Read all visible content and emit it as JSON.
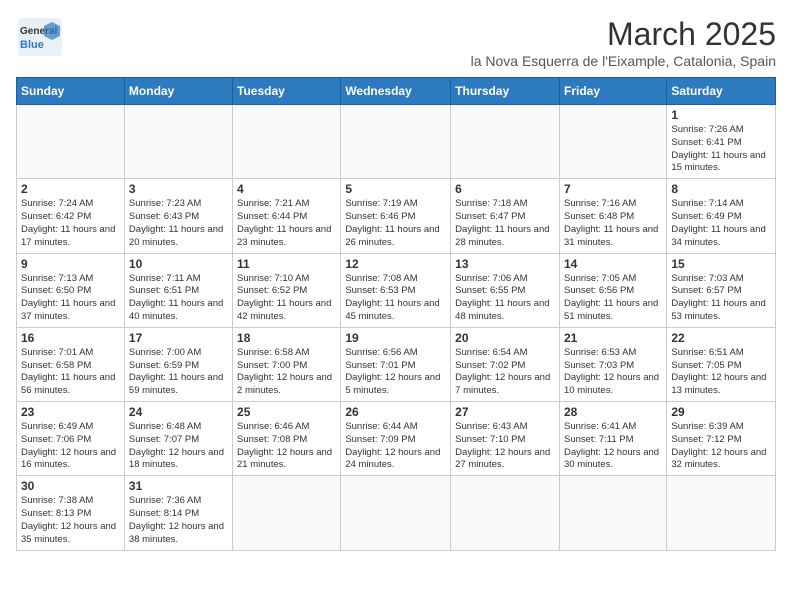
{
  "logo": {
    "text_general": "General",
    "text_blue": "Blue"
  },
  "header": {
    "month": "March 2025",
    "location": "la Nova Esquerra de l'Eixample, Catalonia, Spain"
  },
  "weekdays": [
    "Sunday",
    "Monday",
    "Tuesday",
    "Wednesday",
    "Thursday",
    "Friday",
    "Saturday"
  ],
  "weeks": [
    [
      {
        "day": "",
        "info": ""
      },
      {
        "day": "",
        "info": ""
      },
      {
        "day": "",
        "info": ""
      },
      {
        "day": "",
        "info": ""
      },
      {
        "day": "",
        "info": ""
      },
      {
        "day": "",
        "info": ""
      },
      {
        "day": "1",
        "info": "Sunrise: 7:26 AM\nSunset: 6:41 PM\nDaylight: 11 hours and 15 minutes."
      }
    ],
    [
      {
        "day": "2",
        "info": "Sunrise: 7:24 AM\nSunset: 6:42 PM\nDaylight: 11 hours and 17 minutes."
      },
      {
        "day": "3",
        "info": "Sunrise: 7:23 AM\nSunset: 6:43 PM\nDaylight: 11 hours and 20 minutes."
      },
      {
        "day": "4",
        "info": "Sunrise: 7:21 AM\nSunset: 6:44 PM\nDaylight: 11 hours and 23 minutes."
      },
      {
        "day": "5",
        "info": "Sunrise: 7:19 AM\nSunset: 6:46 PM\nDaylight: 11 hours and 26 minutes."
      },
      {
        "day": "6",
        "info": "Sunrise: 7:18 AM\nSunset: 6:47 PM\nDaylight: 11 hours and 28 minutes."
      },
      {
        "day": "7",
        "info": "Sunrise: 7:16 AM\nSunset: 6:48 PM\nDaylight: 11 hours and 31 minutes."
      },
      {
        "day": "8",
        "info": "Sunrise: 7:14 AM\nSunset: 6:49 PM\nDaylight: 11 hours and 34 minutes."
      }
    ],
    [
      {
        "day": "9",
        "info": "Sunrise: 7:13 AM\nSunset: 6:50 PM\nDaylight: 11 hours and 37 minutes."
      },
      {
        "day": "10",
        "info": "Sunrise: 7:11 AM\nSunset: 6:51 PM\nDaylight: 11 hours and 40 minutes."
      },
      {
        "day": "11",
        "info": "Sunrise: 7:10 AM\nSunset: 6:52 PM\nDaylight: 11 hours and 42 minutes."
      },
      {
        "day": "12",
        "info": "Sunrise: 7:08 AM\nSunset: 6:53 PM\nDaylight: 11 hours and 45 minutes."
      },
      {
        "day": "13",
        "info": "Sunrise: 7:06 AM\nSunset: 6:55 PM\nDaylight: 11 hours and 48 minutes."
      },
      {
        "day": "14",
        "info": "Sunrise: 7:05 AM\nSunset: 6:56 PM\nDaylight: 11 hours and 51 minutes."
      },
      {
        "day": "15",
        "info": "Sunrise: 7:03 AM\nSunset: 6:57 PM\nDaylight: 11 hours and 53 minutes."
      }
    ],
    [
      {
        "day": "16",
        "info": "Sunrise: 7:01 AM\nSunset: 6:58 PM\nDaylight: 11 hours and 56 minutes."
      },
      {
        "day": "17",
        "info": "Sunrise: 7:00 AM\nSunset: 6:59 PM\nDaylight: 11 hours and 59 minutes."
      },
      {
        "day": "18",
        "info": "Sunrise: 6:58 AM\nSunset: 7:00 PM\nDaylight: 12 hours and 2 minutes."
      },
      {
        "day": "19",
        "info": "Sunrise: 6:56 AM\nSunset: 7:01 PM\nDaylight: 12 hours and 5 minutes."
      },
      {
        "day": "20",
        "info": "Sunrise: 6:54 AM\nSunset: 7:02 PM\nDaylight: 12 hours and 7 minutes."
      },
      {
        "day": "21",
        "info": "Sunrise: 6:53 AM\nSunset: 7:03 PM\nDaylight: 12 hours and 10 minutes."
      },
      {
        "day": "22",
        "info": "Sunrise: 6:51 AM\nSunset: 7:05 PM\nDaylight: 12 hours and 13 minutes."
      }
    ],
    [
      {
        "day": "23",
        "info": "Sunrise: 6:49 AM\nSunset: 7:06 PM\nDaylight: 12 hours and 16 minutes."
      },
      {
        "day": "24",
        "info": "Sunrise: 6:48 AM\nSunset: 7:07 PM\nDaylight: 12 hours and 18 minutes."
      },
      {
        "day": "25",
        "info": "Sunrise: 6:46 AM\nSunset: 7:08 PM\nDaylight: 12 hours and 21 minutes."
      },
      {
        "day": "26",
        "info": "Sunrise: 6:44 AM\nSunset: 7:09 PM\nDaylight: 12 hours and 24 minutes."
      },
      {
        "day": "27",
        "info": "Sunrise: 6:43 AM\nSunset: 7:10 PM\nDaylight: 12 hours and 27 minutes."
      },
      {
        "day": "28",
        "info": "Sunrise: 6:41 AM\nSunset: 7:11 PM\nDaylight: 12 hours and 30 minutes."
      },
      {
        "day": "29",
        "info": "Sunrise: 6:39 AM\nSunset: 7:12 PM\nDaylight: 12 hours and 32 minutes."
      }
    ],
    [
      {
        "day": "30",
        "info": "Sunrise: 7:38 AM\nSunset: 8:13 PM\nDaylight: 12 hours and 35 minutes."
      },
      {
        "day": "31",
        "info": "Sunrise: 7:36 AM\nSunset: 8:14 PM\nDaylight: 12 hours and 38 minutes."
      },
      {
        "day": "",
        "info": ""
      },
      {
        "day": "",
        "info": ""
      },
      {
        "day": "",
        "info": ""
      },
      {
        "day": "",
        "info": ""
      },
      {
        "day": "",
        "info": ""
      }
    ]
  ]
}
